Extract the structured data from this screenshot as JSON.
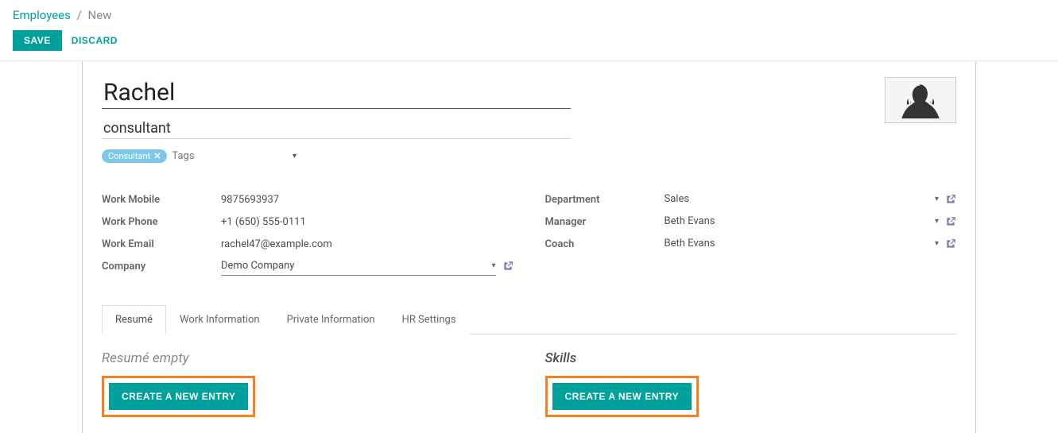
{
  "breadcrumb": {
    "root": "Employees",
    "current": "New"
  },
  "buttons": {
    "save": "SAVE",
    "discard": "DISCARD"
  },
  "form": {
    "name": "Rachel",
    "title": "consultant",
    "tag": "Consultant",
    "tags_placeholder": "Tags",
    "labels": {
      "work_mobile": "Work Mobile",
      "work_phone": "Work Phone",
      "work_email": "Work Email",
      "company": "Company",
      "department": "Department",
      "manager": "Manager",
      "coach": "Coach"
    },
    "values": {
      "work_mobile": "9875693937",
      "work_phone": "+1 (650) 555-0111",
      "work_email": "rachel47@example.com",
      "company": "Demo Company",
      "department": "Sales",
      "manager": "Beth Evans",
      "coach": "Beth Evans"
    }
  },
  "tabs": [
    "Resumé",
    "Work Information",
    "Private Information",
    "HR Settings"
  ],
  "sections": {
    "resume_title": "Resumé empty",
    "skills_title": "Skills",
    "create_entry": "CREATE A NEW ENTRY"
  }
}
